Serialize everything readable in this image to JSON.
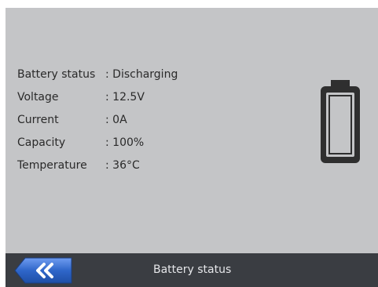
{
  "status": {
    "rows": [
      {
        "label": "Battery status",
        "value": ": Discharging"
      },
      {
        "label": "Voltage",
        "value": ": 12.5V"
      },
      {
        "label": "Current",
        "value": ": 0A"
      },
      {
        "label": "Capacity",
        "value": ": 100%"
      },
      {
        "label": "Temperature",
        "value": ": 36°C"
      }
    ]
  },
  "icons": {
    "battery": "battery-icon",
    "back": "double-chevron-left-icon"
  },
  "footer": {
    "title": "Battery status"
  },
  "colors": {
    "screen_background": "#c4c5c7",
    "footer_background": "#3a3d42",
    "back_button": "#2f66c9",
    "battery_outline": "#2f2f2f"
  }
}
